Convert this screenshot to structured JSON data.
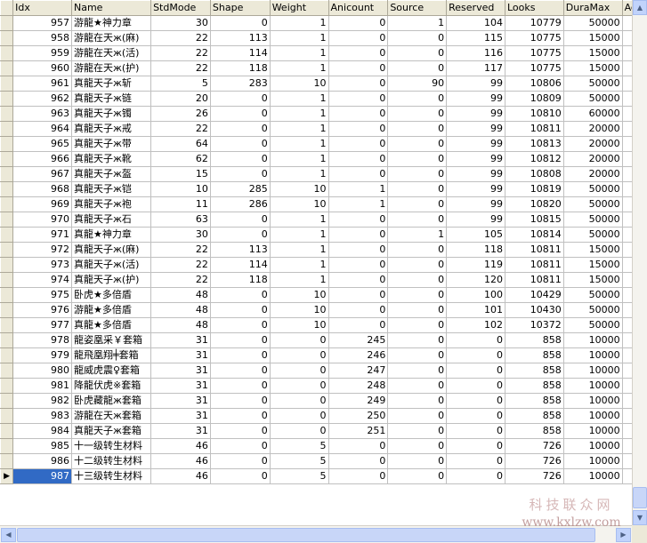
{
  "columns": [
    "Idx",
    "Name",
    "StdMode",
    "Shape",
    "Weight",
    "Anicount",
    "Source",
    "Reserved",
    "Looks",
    "DuraMax",
    "Ac"
  ],
  "rows": [
    [
      "957",
      "游龍★神力章",
      "30",
      "0",
      "1",
      "0",
      "1",
      "104",
      "10779",
      "50000"
    ],
    [
      "958",
      "游龍在天ж(麻)",
      "22",
      "113",
      "1",
      "0",
      "0",
      "115",
      "10775",
      "15000"
    ],
    [
      "959",
      "游龍在天ж(活)",
      "22",
      "114",
      "1",
      "0",
      "0",
      "116",
      "10775",
      "15000"
    ],
    [
      "960",
      "游龍在天ж(护)",
      "22",
      "118",
      "1",
      "0",
      "0",
      "117",
      "10775",
      "15000"
    ],
    [
      "961",
      "真龍天子ж斩",
      "5",
      "283",
      "10",
      "0",
      "90",
      "99",
      "10806",
      "50000"
    ],
    [
      "962",
      "真龍天子ж链",
      "20",
      "0",
      "1",
      "0",
      "0",
      "99",
      "10809",
      "50000"
    ],
    [
      "963",
      "真龍天子ж镯",
      "26",
      "0",
      "1",
      "0",
      "0",
      "99",
      "10810",
      "60000"
    ],
    [
      "964",
      "真龍天子ж戒",
      "22",
      "0",
      "1",
      "0",
      "0",
      "99",
      "10811",
      "20000"
    ],
    [
      "965",
      "真龍天子ж带",
      "64",
      "0",
      "1",
      "0",
      "0",
      "99",
      "10813",
      "20000"
    ],
    [
      "966",
      "真龍天子ж靴",
      "62",
      "0",
      "1",
      "0",
      "0",
      "99",
      "10812",
      "20000"
    ],
    [
      "967",
      "真龍天子ж盔",
      "15",
      "0",
      "1",
      "0",
      "0",
      "99",
      "10808",
      "20000"
    ],
    [
      "968",
      "真龍天子ж铠",
      "10",
      "285",
      "10",
      "1",
      "0",
      "99",
      "10819",
      "50000"
    ],
    [
      "969",
      "真龍天子ж袍",
      "11",
      "286",
      "10",
      "1",
      "0",
      "99",
      "10820",
      "50000"
    ],
    [
      "970",
      "真龍天子ж石",
      "63",
      "0",
      "1",
      "0",
      "0",
      "99",
      "10815",
      "50000"
    ],
    [
      "971",
      "真龍★神力章",
      "30",
      "0",
      "1",
      "0",
      "1",
      "105",
      "10814",
      "50000"
    ],
    [
      "972",
      "真龍天子ж(麻)",
      "22",
      "113",
      "1",
      "0",
      "0",
      "118",
      "10811",
      "15000"
    ],
    [
      "973",
      "真龍天子ж(活)",
      "22",
      "114",
      "1",
      "0",
      "0",
      "119",
      "10811",
      "15000"
    ],
    [
      "974",
      "真龍天子ж(护)",
      "22",
      "118",
      "1",
      "0",
      "0",
      "120",
      "10811",
      "15000"
    ],
    [
      "975",
      "卧虎★多倍盾",
      "48",
      "0",
      "10",
      "0",
      "0",
      "100",
      "10429",
      "50000"
    ],
    [
      "976",
      "游龍★多倍盾",
      "48",
      "0",
      "10",
      "0",
      "0",
      "101",
      "10430",
      "50000"
    ],
    [
      "977",
      "真龍★多倍盾",
      "48",
      "0",
      "10",
      "0",
      "0",
      "102",
      "10372",
      "50000"
    ],
    [
      "978",
      "龍姿凰采￥套箱",
      "31",
      "0",
      "0",
      "245",
      "0",
      "0",
      "858",
      "10000"
    ],
    [
      "979",
      "龍飛凰翔╪套箱",
      "31",
      "0",
      "0",
      "246",
      "0",
      "0",
      "858",
      "10000"
    ],
    [
      "980",
      "龍威虎震♀套箱",
      "31",
      "0",
      "0",
      "247",
      "0",
      "0",
      "858",
      "10000"
    ],
    [
      "981",
      "降龍伏虎※套箱",
      "31",
      "0",
      "0",
      "248",
      "0",
      "0",
      "858",
      "10000"
    ],
    [
      "982",
      "卧虎藏龍ж套箱",
      "31",
      "0",
      "0",
      "249",
      "0",
      "0",
      "858",
      "10000"
    ],
    [
      "983",
      "游龍在天ж套箱",
      "31",
      "0",
      "0",
      "250",
      "0",
      "0",
      "858",
      "10000"
    ],
    [
      "984",
      "真龍天子ж套箱",
      "31",
      "0",
      "0",
      "251",
      "0",
      "0",
      "858",
      "10000"
    ],
    [
      "985",
      "十一级转生材料",
      "46",
      "0",
      "5",
      "0",
      "0",
      "0",
      "726",
      "10000"
    ],
    [
      "986",
      "十二级转生材料",
      "46",
      "0",
      "5",
      "0",
      "0",
      "0",
      "726",
      "10000"
    ],
    [
      "987",
      "十三级转生材料",
      "46",
      "0",
      "5",
      "0",
      "0",
      "0",
      "726",
      "10000"
    ]
  ],
  "selected_row_index": 30,
  "current_row_marker": "▶",
  "watermark": {
    "brand": "科技联众网",
    "url": "www.kxlzw.com"
  },
  "colors": {
    "selection": "#316ac5",
    "header_bg": "#ece9d8",
    "watermark": "#c9a0a0"
  }
}
